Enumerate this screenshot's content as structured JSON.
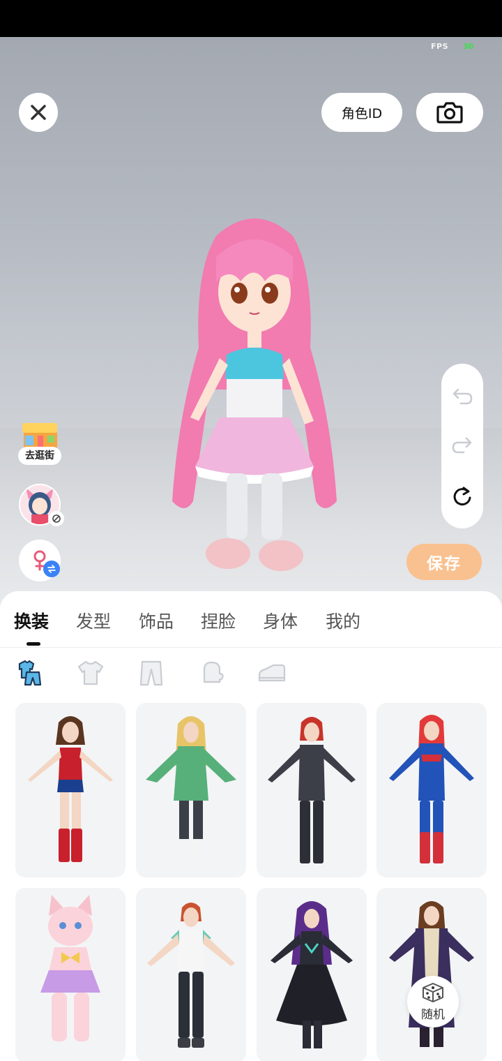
{
  "hud": {
    "fps_label": "FPS",
    "fps_value": "30"
  },
  "top_bar": {
    "role_id_label": "角色ID"
  },
  "side": {
    "shop_label": "去逛街"
  },
  "actions": {
    "save_label": "保存",
    "random_label": "随机"
  },
  "tabs": [
    {
      "label": "换装",
      "active": true
    },
    {
      "label": "发型",
      "active": false
    },
    {
      "label": "饰品",
      "active": false
    },
    {
      "label": "捏脸",
      "active": false
    },
    {
      "label": "身体",
      "active": false
    },
    {
      "label": "我的",
      "active": false
    }
  ],
  "subcategories": [
    {
      "icon": "outfit-set-icon",
      "active": true
    },
    {
      "icon": "shirt-icon",
      "active": false
    },
    {
      "icon": "pants-icon",
      "active": false
    },
    {
      "icon": "glove-icon",
      "active": false
    },
    {
      "icon": "shoe-icon",
      "active": false
    }
  ],
  "outfits": [
    {
      "name": "red-blue-heroine-outfit"
    },
    {
      "name": "green-kimono-outfit"
    },
    {
      "name": "black-combat-suit-outfit"
    },
    {
      "name": "red-blue-star-suit-outfit"
    },
    {
      "name": "pink-cat-dress-outfit"
    },
    {
      "name": "white-tee-track-pants-outfit"
    },
    {
      "name": "purple-gothic-dress-outfit"
    },
    {
      "name": "purple-robe-uniform-outfit"
    }
  ],
  "colors": {
    "save": "#f9c18f",
    "accent_badge": "#3b82f6",
    "fps_green": "#3ce04a"
  }
}
